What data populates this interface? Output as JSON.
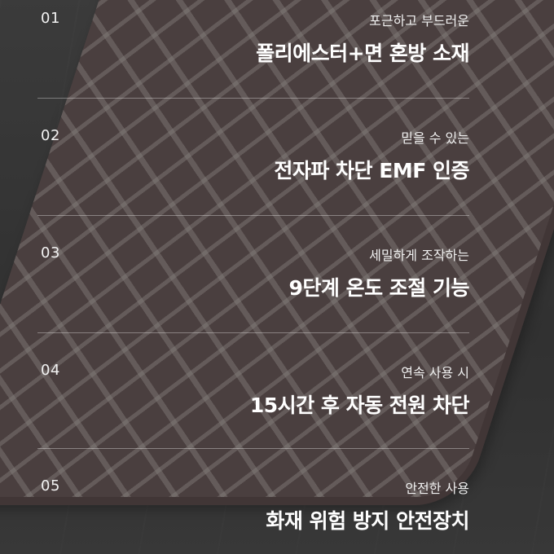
{
  "features": [
    {
      "number": "01",
      "subtitle": "포근하고 부드러운",
      "title": "폴리에스터+면 혼방 소재"
    },
    {
      "number": "02",
      "subtitle": "믿을 수 있는",
      "title": "전자파 차단 EMF 인증"
    },
    {
      "number": "03",
      "subtitle": "세밀하게 조작하는",
      "title": "9단계 온도 조절 기능"
    },
    {
      "number": "04",
      "subtitle": "연속 사용 시",
      "title": "15시간 후 자동 전원 차단"
    },
    {
      "number": "05",
      "subtitle": "안전한 사용",
      "title": "화재 위험 방지 안전장치"
    }
  ]
}
